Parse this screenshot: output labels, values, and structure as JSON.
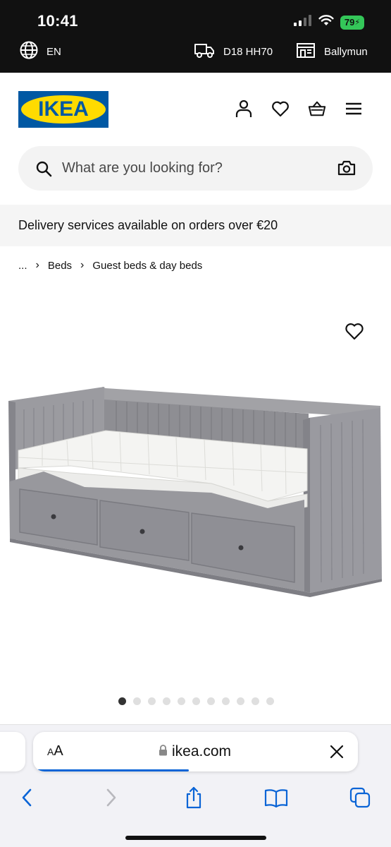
{
  "status": {
    "time": "10:41",
    "battery": "79"
  },
  "store_bar": {
    "language": "EN",
    "postcode": "D18 HH70",
    "store": "Ballymun"
  },
  "brand": {
    "logo_text": "IKEA",
    "blue": "#0058a3",
    "yellow": "#ffdb00"
  },
  "header_icons": [
    "user-icon",
    "heart-icon",
    "basket-icon",
    "menu-icon"
  ],
  "search": {
    "placeholder": "What are you looking for?"
  },
  "delivery": {
    "text": "Delivery services available on orders over €20"
  },
  "breadcrumb": {
    "ellipsis": "...",
    "items": [
      "Beds",
      "Guest beds & day beds"
    ]
  },
  "carousel": {
    "count": 11,
    "active_index": 0
  },
  "browser": {
    "aa_small": "A",
    "aa_large": "A",
    "url": "ikea.com",
    "load_progress": 0.47,
    "accent": "#0a64d6"
  }
}
